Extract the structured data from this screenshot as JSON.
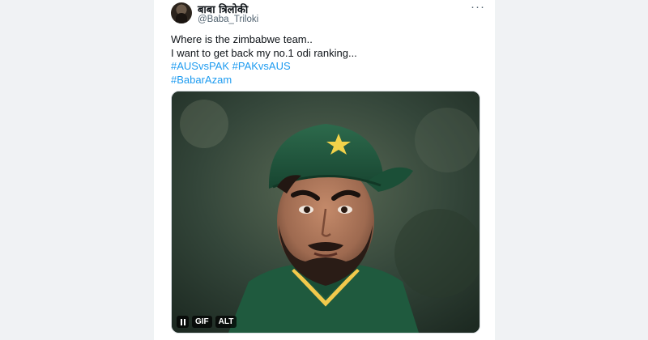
{
  "tweet": {
    "display_name": "बाबा त्रिलोकी",
    "handle": "@Baba_Triloki",
    "more_label": "···",
    "lines": [
      "Where is the zimbabwe team..",
      "I want to get back my no.1 odi ranking..."
    ],
    "hashtags_line1": [
      "#AUSvsPAK",
      "#PAKvsAUS"
    ],
    "hashtags_line2": [
      "#BabarAzam"
    ],
    "media": {
      "type": "gif",
      "gif_label": "GIF",
      "alt_label": "ALT"
    }
  },
  "colors": {
    "link": "#1d9bf0",
    "text": "#0f1419",
    "secondary": "#536471",
    "background": "#f0f2f4"
  },
  "icons": {
    "more": "more-dots-icon",
    "pause": "pause-icon",
    "avatar": "profile-avatar"
  }
}
